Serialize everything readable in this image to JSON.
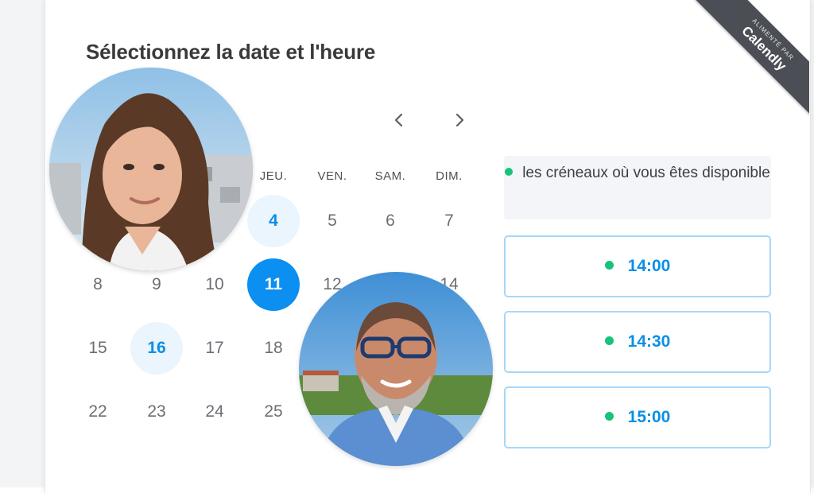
{
  "page_title": "Sélectionnez la date et l'heure",
  "ribbon": {
    "small_text": "ALIMENTÉ PAR",
    "brand": "Calendly"
  },
  "nav": {
    "prev_icon": "chevron-left-icon",
    "next_icon": "chevron-right-icon"
  },
  "weekdays": [
    "JEU.",
    "VEN.",
    "SAM.",
    "DIM."
  ],
  "days": {
    "row1": [
      "4",
      "5",
      "6",
      "7"
    ],
    "row2": [
      "8",
      "9",
      "10",
      "11",
      "12",
      "14"
    ],
    "row3": [
      "15",
      "16",
      "17",
      "18"
    ],
    "row4": [
      "22",
      "23",
      "24",
      "25"
    ]
  },
  "legend": {
    "text": "les créneaux où vous êtes disponible",
    "dot_color": "#17c37b"
  },
  "slots": [
    "14:00",
    "14:30",
    "15:00"
  ],
  "colors": {
    "accent": "#0b8ff0",
    "available_bg": "#eaf5fd",
    "slot_border": "#a8d7f7",
    "available_dot": "#17c37b"
  }
}
